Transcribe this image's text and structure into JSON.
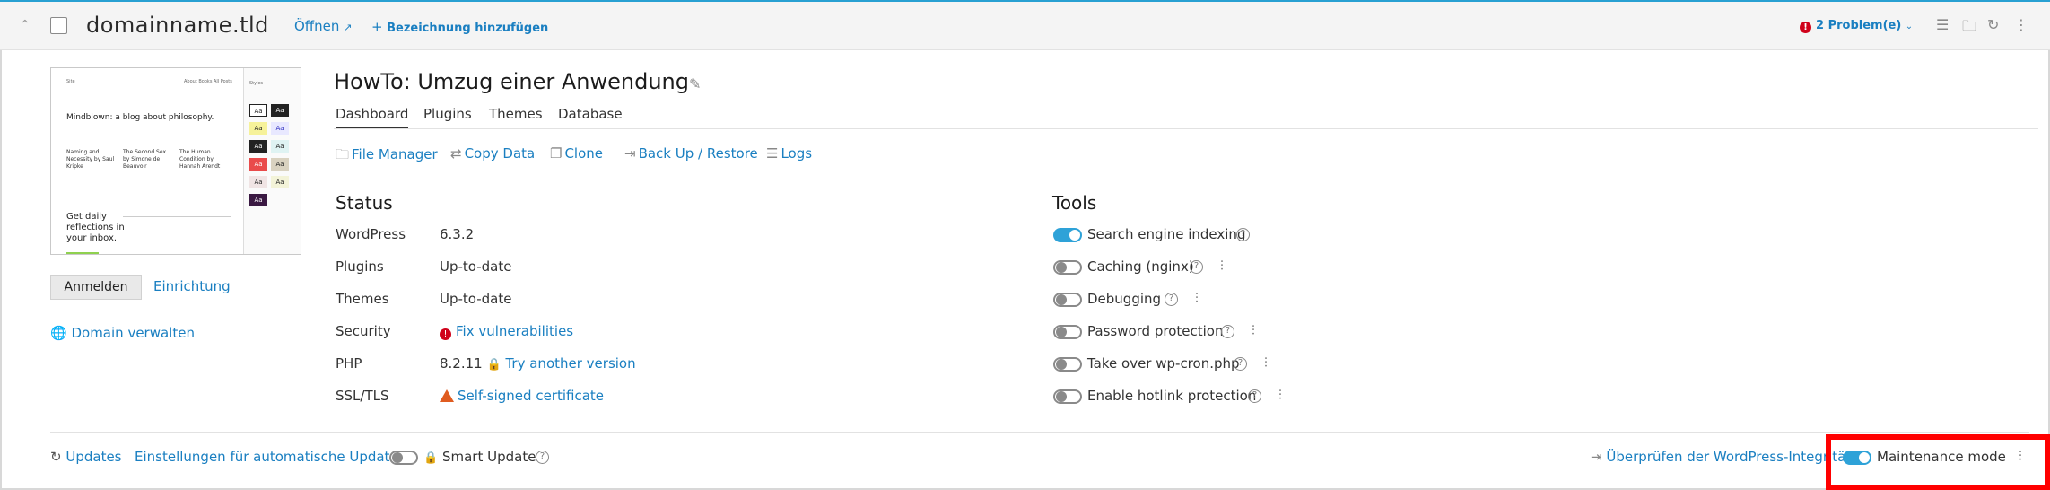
{
  "header": {
    "domain": "domainname.tld",
    "open_label": "Öffnen",
    "add_label": "Bezeichnung hinzufügen",
    "problems_label": "2 Problem(e)",
    "problems_count": "!"
  },
  "thumbnail": {
    "site_name": "Site",
    "nav": "About  Books  All Posts",
    "headline": "Mindblown: a blog about philosophy.",
    "posts": [
      "Naming and Necessity by Saul Kripke",
      "The Second Sex by Simone de Beauvoir",
      "The Human Condition by Hannah Arendt"
    ],
    "cta": "Get daily reflections in your inbox.",
    "side_title": "Styles",
    "swatch_text": "Aa"
  },
  "left": {
    "login_button": "Anmelden",
    "setup_link": "Einrichtung",
    "manage_domain": "Domain verwalten"
  },
  "site": {
    "title": "HowTo: Umzug einer Anwendung",
    "tabs": [
      "Dashboard",
      "Plugins",
      "Themes",
      "Database"
    ],
    "actions": [
      "File Manager",
      "Copy Data",
      "Clone",
      "Back Up / Restore",
      "Logs"
    ]
  },
  "status": {
    "title": "Status",
    "rows": [
      {
        "label": "WordPress",
        "value": "6.3.2"
      },
      {
        "label": "Plugins",
        "value": "Up-to-date"
      },
      {
        "label": "Themes",
        "value": "Up-to-date"
      },
      {
        "label": "Security",
        "value": "Fix vulnerabilities"
      },
      {
        "label": "PHP",
        "value": "8.2.11",
        "link": "Try another version"
      },
      {
        "label": "SSL/TLS",
        "value": "Self-signed certificate"
      }
    ]
  },
  "tools": {
    "title": "Tools",
    "items": [
      {
        "label": "Search engine indexing",
        "on": true
      },
      {
        "label": "Caching (nginx)",
        "on": false
      },
      {
        "label": "Debugging",
        "on": false
      },
      {
        "label": "Password protection",
        "on": false
      },
      {
        "label": "Take over wp-cron.php",
        "on": false
      },
      {
        "label": "Enable hotlink protection",
        "on": false
      }
    ]
  },
  "bottom": {
    "updates": "Updates",
    "auto_updates": "Einstellungen für automatische Updates",
    "smart_update": "Smart Update",
    "integrity": "Überprüfen der WordPress-Integrität",
    "maintenance": "Maintenance mode",
    "maintenance_on": true,
    "smart_update_on": false
  },
  "colors": {
    "accent": "#1a7fc1",
    "toggle_on": "#2ea2d8",
    "error": "#d0021b",
    "warning": "#e05c20",
    "highlight": "#ff0000"
  }
}
